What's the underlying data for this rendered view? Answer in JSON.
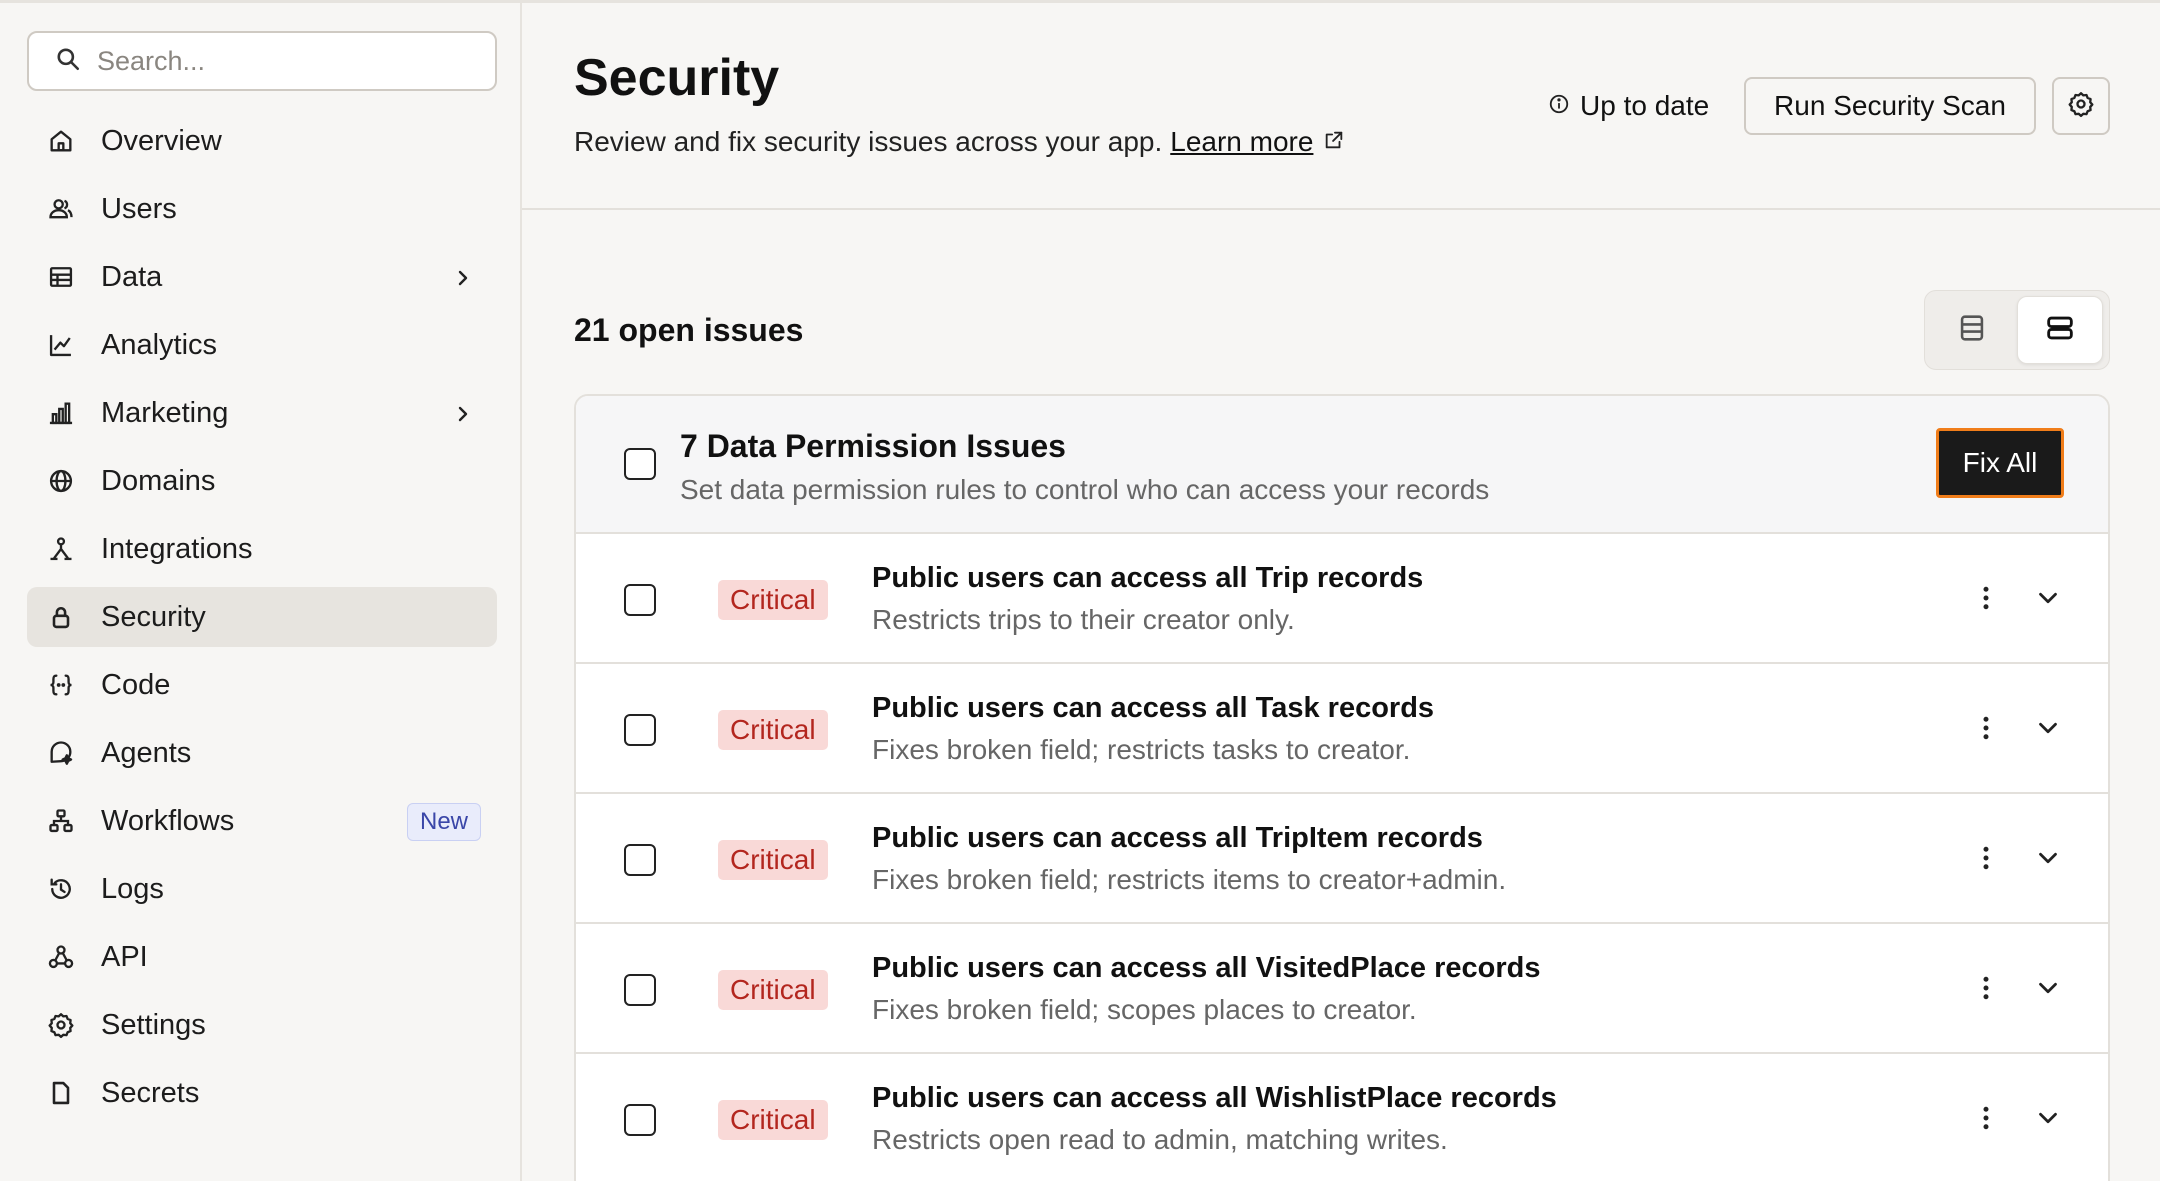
{
  "search": {
    "placeholder": "Search..."
  },
  "sidebar": {
    "items": [
      {
        "label": "Overview",
        "icon": "home-icon"
      },
      {
        "label": "Users",
        "icon": "users-icon"
      },
      {
        "label": "Data",
        "icon": "table-icon",
        "has_submenu": true
      },
      {
        "label": "Analytics",
        "icon": "line-chart-icon"
      },
      {
        "label": "Marketing",
        "icon": "bar-chart-icon",
        "has_submenu": true
      },
      {
        "label": "Domains",
        "icon": "globe-icon"
      },
      {
        "label": "Integrations",
        "icon": "integrations-icon"
      },
      {
        "label": "Security",
        "icon": "lock-icon",
        "active": true
      },
      {
        "label": "Code",
        "icon": "code-braces-icon"
      },
      {
        "label": "Agents",
        "icon": "agent-icon"
      },
      {
        "label": "Workflows",
        "icon": "workflow-icon",
        "badge": "New"
      },
      {
        "label": "Logs",
        "icon": "history-icon"
      },
      {
        "label": "API",
        "icon": "api-icon"
      },
      {
        "label": "Settings",
        "icon": "gear-icon"
      },
      {
        "label": "Secrets",
        "icon": "file-icon"
      }
    ]
  },
  "header": {
    "title": "Security",
    "subtitle": "Review and fix security issues across your app.",
    "learn_more": "Learn more",
    "status": "Up to date",
    "run_scan_label": "Run Security Scan"
  },
  "issues": {
    "count_label": "21 open issues",
    "group": {
      "title": "7 Data Permission Issues",
      "description": "Set data permission rules to control who can access your records",
      "fix_all_label": "Fix All"
    },
    "rows": [
      {
        "severity": "Critical",
        "title": "Public users can access all Trip records",
        "description": "Restricts trips to their creator only."
      },
      {
        "severity": "Critical",
        "title": "Public users can access all Task records",
        "description": "Fixes broken field; restricts tasks to creator."
      },
      {
        "severity": "Critical",
        "title": "Public users can access all TripItem records",
        "description": "Fixes broken field; restricts items to creator+admin."
      },
      {
        "severity": "Critical",
        "title": "Public users can access all VisitedPlace records",
        "description": "Fixes broken field; scopes places to creator."
      },
      {
        "severity": "Critical",
        "title": "Public users can access all WishlistPlace records",
        "description": "Restricts open read to admin, matching writes."
      }
    ]
  },
  "colors": {
    "critical_bg": "#f9d9d7",
    "critical_text": "#b3261e",
    "fix_all_border": "#f07d1a",
    "active_nav_bg": "#e7e4df"
  }
}
